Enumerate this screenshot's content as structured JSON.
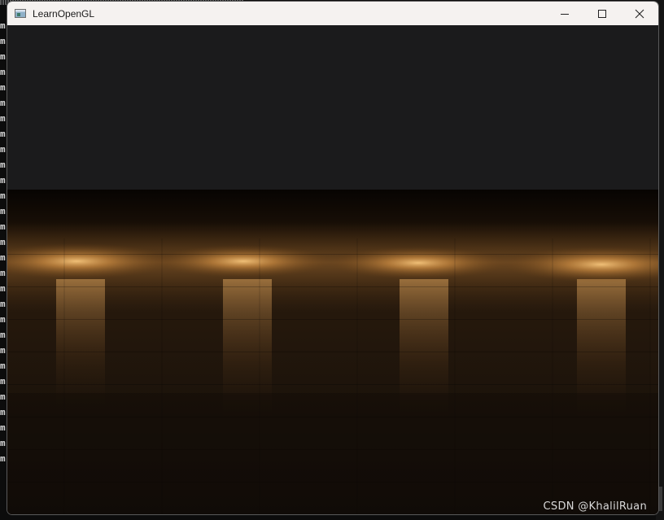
{
  "window": {
    "title": "LearnOpenGL",
    "icon": "app-window-icon",
    "buttons": [
      "minimize-icon",
      "maximize-icon",
      "close-icon"
    ]
  },
  "console": {
    "line_char": "m",
    "visible_line_count": 29
  },
  "watermark": "CSDN @KhalilRuan",
  "colors": {
    "titlebar": "#f5f2f0",
    "sky": "#1b1b1c",
    "light_glow": "#f2b76b",
    "floor_dark": "#120d09"
  }
}
